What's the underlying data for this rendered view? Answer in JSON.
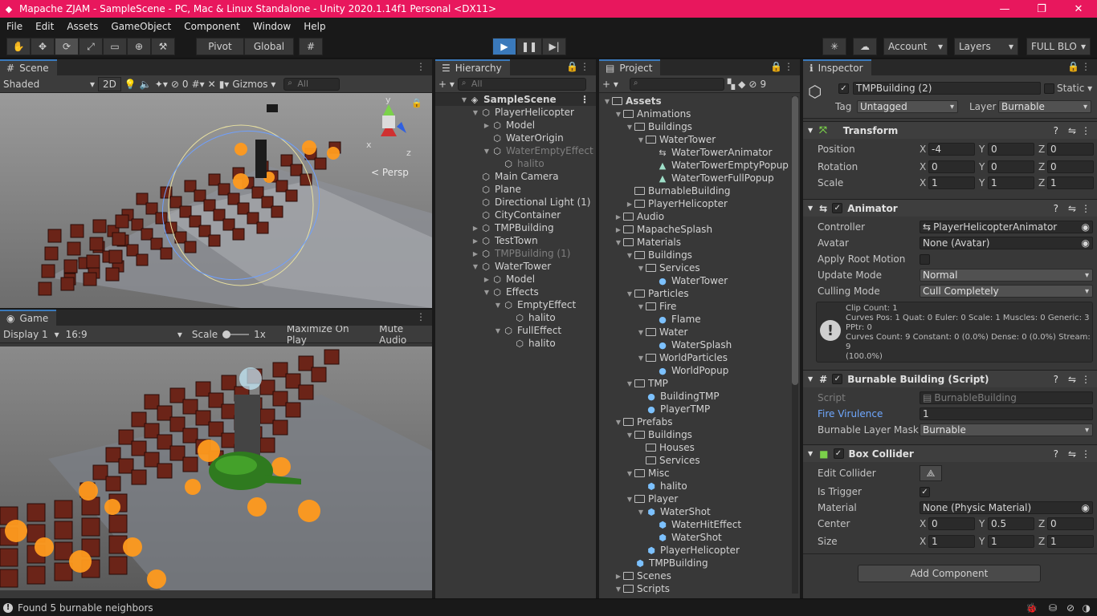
{
  "window": {
    "title": "Mapache ZJAM - SampleScene - PC, Mac & Linux Standalone - Unity 2020.1.14f1 Personal <DX11>"
  },
  "menu": [
    "File",
    "Edit",
    "Assets",
    "GameObject",
    "Component",
    "Window",
    "Help"
  ],
  "toolbar": {
    "pivot": "Pivot",
    "global": "Global",
    "account": "Account",
    "layers": "Layers",
    "layout": "FULL BLO"
  },
  "scene": {
    "tab": "Scene",
    "shading": "Shaded",
    "mode_2d": "2D",
    "hidden_count": "0",
    "gizmos": "Gizmos",
    "search_placeholder": "All",
    "persp": "Persp",
    "axis_x": "x",
    "axis_y": "y",
    "axis_z": "z"
  },
  "game": {
    "tab": "Game",
    "display": "Display 1",
    "aspect": "16:9",
    "scale_label": "Scale",
    "scale_value": "1x",
    "maximize": "Maximize On Play",
    "mute": "Mute Audio"
  },
  "hierarchy": {
    "tab": "Hierarchy",
    "search_placeholder": "All",
    "scene": "SampleScene",
    "rows": [
      {
        "label": "PlayerHelicopter",
        "depth": 1,
        "arrow": "open",
        "dim": false,
        "prefab": false
      },
      {
        "label": "Model",
        "depth": 2,
        "arrow": "closed",
        "dim": false,
        "prefab": false
      },
      {
        "label": "WaterOrigin",
        "depth": 2,
        "arrow": "",
        "dim": false,
        "prefab": false
      },
      {
        "label": "WaterEmptyEffect",
        "depth": 2,
        "arrow": "open",
        "dim": true,
        "prefab": false
      },
      {
        "label": "halito",
        "depth": 3,
        "arrow": "",
        "dim": true,
        "prefab": false
      },
      {
        "label": "Main Camera",
        "depth": 1,
        "arrow": "",
        "dim": false,
        "prefab": false
      },
      {
        "label": "Plane",
        "depth": 1,
        "arrow": "",
        "dim": false,
        "prefab": false
      },
      {
        "label": "Directional Light (1)",
        "depth": 1,
        "arrow": "",
        "dim": false,
        "prefab": false
      },
      {
        "label": "CityContainer",
        "depth": 1,
        "arrow": "",
        "dim": false,
        "prefab": false
      },
      {
        "label": "TMPBuilding",
        "depth": 1,
        "arrow": "closed",
        "dim": false,
        "prefab": false
      },
      {
        "label": "TestTown",
        "depth": 1,
        "arrow": "closed",
        "dim": false,
        "prefab": false
      },
      {
        "label": "TMPBuilding (1)",
        "depth": 1,
        "arrow": "closed",
        "dim": true,
        "prefab": false
      },
      {
        "label": "WaterTower",
        "depth": 1,
        "arrow": "open",
        "dim": false,
        "prefab": false
      },
      {
        "label": "Model",
        "depth": 2,
        "arrow": "closed",
        "dim": false,
        "prefab": false
      },
      {
        "label": "Effects",
        "depth": 2,
        "arrow": "open",
        "dim": false,
        "prefab": false
      },
      {
        "label": "EmptyEffect",
        "depth": 3,
        "arrow": "open",
        "dim": false,
        "prefab": false
      },
      {
        "label": "halito",
        "depth": 4,
        "arrow": "",
        "dim": false,
        "prefab": false
      },
      {
        "label": "FullEffect",
        "depth": 3,
        "arrow": "open",
        "dim": false,
        "prefab": false
      },
      {
        "label": "halito",
        "depth": 4,
        "arrow": "",
        "dim": false,
        "prefab": false
      }
    ]
  },
  "project": {
    "tab": "Project",
    "hidden_count": "9",
    "rows": [
      {
        "label": "Assets",
        "depth": 0,
        "arrow": "open",
        "type": "folder",
        "bold": true
      },
      {
        "label": "Animations",
        "depth": 1,
        "arrow": "open",
        "type": "folder"
      },
      {
        "label": "Buildings",
        "depth": 2,
        "arrow": "open",
        "type": "folder"
      },
      {
        "label": "WaterTower",
        "depth": 3,
        "arrow": "open",
        "type": "folder"
      },
      {
        "label": "WaterTowerAnimator",
        "depth": 4,
        "arrow": "",
        "type": "animator"
      },
      {
        "label": "WaterTowerEmptyPopup",
        "depth": 4,
        "arrow": "",
        "type": "anim"
      },
      {
        "label": "WaterTowerFullPopup",
        "depth": 4,
        "arrow": "",
        "type": "anim"
      },
      {
        "label": "BurnableBuilding",
        "depth": 2,
        "arrow": "",
        "type": "folder"
      },
      {
        "label": "PlayerHelicopter",
        "depth": 2,
        "arrow": "closed",
        "type": "folder"
      },
      {
        "label": "Audio",
        "depth": 1,
        "arrow": "closed",
        "type": "folder"
      },
      {
        "label": "MapacheSplash",
        "depth": 1,
        "arrow": "closed",
        "type": "folder"
      },
      {
        "label": "Materials",
        "depth": 1,
        "arrow": "open",
        "type": "folder"
      },
      {
        "label": "Buildings",
        "depth": 2,
        "arrow": "open",
        "type": "folder"
      },
      {
        "label": "Services",
        "depth": 3,
        "arrow": "open",
        "type": "folder"
      },
      {
        "label": "WaterTower",
        "depth": 4,
        "arrow": "",
        "type": "material"
      },
      {
        "label": "Particles",
        "depth": 2,
        "arrow": "open",
        "type": "folder"
      },
      {
        "label": "Fire",
        "depth": 3,
        "arrow": "open",
        "type": "folder"
      },
      {
        "label": "Flame",
        "depth": 4,
        "arrow": "",
        "type": "material"
      },
      {
        "label": "Water",
        "depth": 3,
        "arrow": "open",
        "type": "folder"
      },
      {
        "label": "WaterSplash",
        "depth": 4,
        "arrow": "",
        "type": "material"
      },
      {
        "label": "WorldParticles",
        "depth": 3,
        "arrow": "open",
        "type": "folder"
      },
      {
        "label": "WorldPopup",
        "depth": 4,
        "arrow": "",
        "type": "material"
      },
      {
        "label": "TMP",
        "depth": 2,
        "arrow": "open",
        "type": "folder"
      },
      {
        "label": "BuildingTMP",
        "depth": 3,
        "arrow": "",
        "type": "material"
      },
      {
        "label": "PlayerTMP",
        "depth": 3,
        "arrow": "",
        "type": "material"
      },
      {
        "label": "Prefabs",
        "depth": 1,
        "arrow": "open",
        "type": "folder"
      },
      {
        "label": "Buildings",
        "depth": 2,
        "arrow": "open",
        "type": "folder"
      },
      {
        "label": "Houses",
        "depth": 3,
        "arrow": "",
        "type": "folder"
      },
      {
        "label": "Services",
        "depth": 3,
        "arrow": "",
        "type": "folder"
      },
      {
        "label": "Misc",
        "depth": 2,
        "arrow": "open",
        "type": "folder"
      },
      {
        "label": "halito",
        "depth": 3,
        "arrow": "",
        "type": "prefab"
      },
      {
        "label": "Player",
        "depth": 2,
        "arrow": "open",
        "type": "folder"
      },
      {
        "label": "WaterShot",
        "depth": 3,
        "arrow": "open",
        "type": "prefab"
      },
      {
        "label": "WaterHitEffect",
        "depth": 4,
        "arrow": "",
        "type": "prefab"
      },
      {
        "label": "WaterShot",
        "depth": 4,
        "arrow": "",
        "type": "prefab"
      },
      {
        "label": "PlayerHelicopter",
        "depth": 3,
        "arrow": "",
        "type": "prefab"
      },
      {
        "label": "TMPBuilding",
        "depth": 2,
        "arrow": "",
        "type": "prefab"
      },
      {
        "label": "Scenes",
        "depth": 1,
        "arrow": "closed",
        "type": "folder"
      },
      {
        "label": "Scripts",
        "depth": 1,
        "arrow": "open",
        "type": "folder"
      }
    ]
  },
  "inspector": {
    "tab": "Inspector",
    "object_name": "TMPBuilding (2)",
    "static": "Static",
    "tag_label": "Tag",
    "tag": "Untagged",
    "layer_label": "Layer",
    "layer": "Burnable",
    "transform": {
      "title": "Transform",
      "position": "Position",
      "rotation": "Rotation",
      "scale": "Scale",
      "pos": [
        "-4",
        "0",
        "0"
      ],
      "rot": [
        "0",
        "0",
        "0"
      ],
      "scl": [
        "1",
        "1",
        "1"
      ]
    },
    "animator": {
      "title": "Animator",
      "controller_label": "Controller",
      "controller": "PlayerHelicopterAnimator",
      "avatar_label": "Avatar",
      "avatar": "None (Avatar)",
      "apply_root": "Apply Root Motion",
      "update_mode_label": "Update Mode",
      "update_mode": "Normal",
      "culling_label": "Culling Mode",
      "culling": "Cull Completely",
      "info": [
        "Clip Count: 1",
        "Curves Pos: 1 Quat: 0 Euler: 0 Scale: 1 Muscles: 0 Generic: 3",
        "PPtr: 0",
        "Curves Count: 9 Constant: 0 (0.0%) Dense: 0 (0.0%) Stream: 9",
        "(100.0%)"
      ]
    },
    "burnable": {
      "title": "Burnable Building (Script)",
      "script_label": "Script",
      "script": "BurnableBuilding",
      "virulence_label": "Fire Virulence",
      "virulence": "1",
      "mask_label": "Burnable Layer Mask",
      "mask": "Burnable"
    },
    "collider": {
      "title": "Box Collider",
      "edit_label": "Edit Collider",
      "trigger_label": "Is Trigger",
      "material_label": "Material",
      "material": "None (Physic Material)",
      "center_label": "Center",
      "size_label": "Size",
      "center": [
        "0",
        "0.5",
        "0"
      ],
      "size": [
        "1",
        "1",
        "1"
      ]
    },
    "add_component": "Add Component"
  },
  "status": {
    "message": "Found 5 burnable neighbors"
  },
  "colors": {
    "accent": "#3a79bb",
    "titlebar": "#e8175d",
    "fire": "#ff9a1e",
    "building": "#6b2418"
  }
}
